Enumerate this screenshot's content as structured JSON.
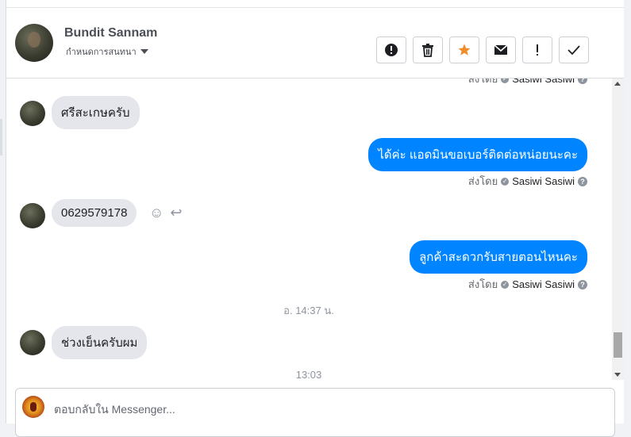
{
  "header": {
    "name": "Bundit Sannam",
    "subtitle": "กำหนดการสนทนา",
    "actions": [
      {
        "name": "spam-button",
        "glyph": "!",
        "icon": "alert-circle-icon"
      },
      {
        "name": "delete-button",
        "glyph": "🗑",
        "icon": "trash-icon"
      },
      {
        "name": "star-button",
        "glyph": "★",
        "icon": "star-icon",
        "color": "#f28c28"
      },
      {
        "name": "mark-unread-button",
        "glyph": "✉",
        "icon": "envelope-icon"
      },
      {
        "name": "follow-up-button",
        "glyph": "!",
        "icon": "exclamation-icon"
      },
      {
        "name": "mark-done-button",
        "glyph": "✓",
        "icon": "checkmark-icon"
      }
    ]
  },
  "thread": {
    "top_sent_by": {
      "prefix": "ส่งโดย",
      "sender": "Sasiwi Sasiwi"
    },
    "messages": [
      {
        "from": "customer",
        "text": "ศรีสะเกษครับ"
      },
      {
        "from": "page",
        "text": "ได้ค่ะ แอดมินขอเบอร์ติดต่อหน่อยนะคะ",
        "sent_by_prefix": "ส่งโดย",
        "sender": "Sasiwi Sasiwi"
      },
      {
        "from": "customer",
        "text": "0629579178"
      },
      {
        "from": "page",
        "text": "ลูกค้าสะดวกรับสายตอนไหนคะ",
        "sent_by_prefix": "ส่งโดย",
        "sender": "Sasiwi Sasiwi"
      },
      {
        "timestamp": "อ. 14:37 น."
      },
      {
        "from": "customer",
        "text": "ช่วงเย็นครับผม"
      },
      {
        "timestamp": "13:03"
      }
    ]
  },
  "composer": {
    "placeholder": "ตอบกลับใน Messenger..."
  },
  "colors": {
    "outgoing_bubble": "#0084ff",
    "incoming_bubble": "#e4e6eb"
  }
}
